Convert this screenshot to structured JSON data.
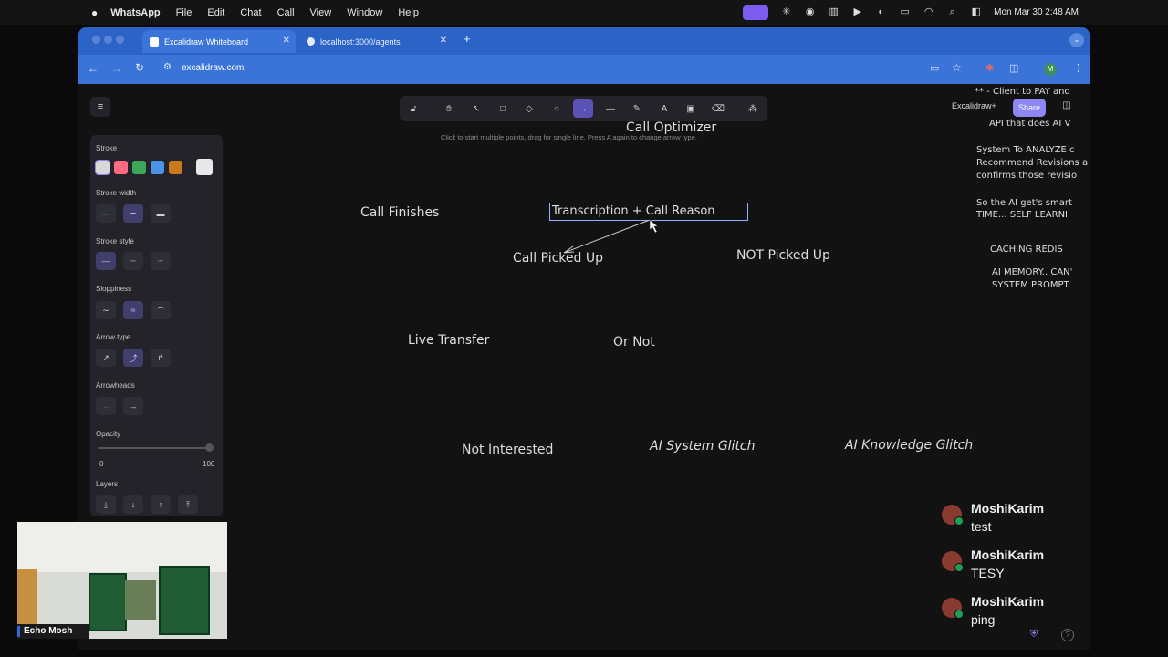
{
  "menubar": {
    "app": "WhatsApp",
    "items": [
      "File",
      "Edit",
      "Chat",
      "Call",
      "View",
      "Window",
      "Help"
    ],
    "clock": "Mon Mar 30  2:48 AM"
  },
  "browser": {
    "tabs": [
      {
        "label": "Excalidraw Whiteboard"
      },
      {
        "label": "localhost:3000/agents"
      }
    ],
    "new_tab": "+",
    "url": "excalidraw.com",
    "profile_initial": "M"
  },
  "excalidraw": {
    "hint": "Click to start multiple points, drag for single line. Press A again to change arrow type.",
    "brand": "Excalidraw+",
    "share_label": "Share",
    "tools": [
      "lock",
      "hand",
      "select",
      "rectangle",
      "diamond",
      "ellipse",
      "arrow",
      "line",
      "pencil",
      "text",
      "image",
      "eraser",
      "more"
    ],
    "props": {
      "stroke": "Stroke",
      "stroke_width": "Stroke width",
      "stroke_style": "Stroke style",
      "sloppiness": "Sloppiness",
      "arrow_type": "Arrow type",
      "arrowheads": "Arrowheads",
      "opacity": "Opacity",
      "opacity_min": "0",
      "opacity_max": "100",
      "layers": "Layers"
    },
    "stroke_colors": [
      "#d8d8d8",
      "#ff6b81",
      "#3ca75b",
      "#4a94e8",
      "#c97a1a",
      "#e8e8e8"
    ],
    "canvas_text": {
      "call_optimizer": "Call Optimizer",
      "call_finishes": "Call Finishes",
      "transcription": "Transcription + Call Reason",
      "call_picked_up": "Call Picked Up",
      "not_picked_up": "NOT Picked Up",
      "live_transfer": "Live Transfer",
      "or_not": "Or Not",
      "not_interested": "Not Interested",
      "ai_system_glitch": "AI System Glitch",
      "ai_knowledge_glitch": "AI Knowledge Glitch"
    },
    "notes": {
      "line1": "** - Client to PAY and",
      "line2": "API that does AI V",
      "line3": "System To ANALYZE c",
      "line4": "Recommend Revisions a",
      "line5": "confirms those revisio",
      "line6": "So the AI get's smart",
      "line7": "TIME... SELF LEARNI",
      "line8": "CACHING REDIS",
      "line9": "AI MEMORY.. CAN'",
      "line10": "SYSTEM PROMPT"
    }
  },
  "video": {
    "name": "Echo Mosh"
  },
  "chat": [
    {
      "name": "MoshiKarim",
      "text": "test"
    },
    {
      "name": "MoshiKarim",
      "text": "TESY"
    },
    {
      "name": "MoshiKarim",
      "text": "ping"
    }
  ]
}
